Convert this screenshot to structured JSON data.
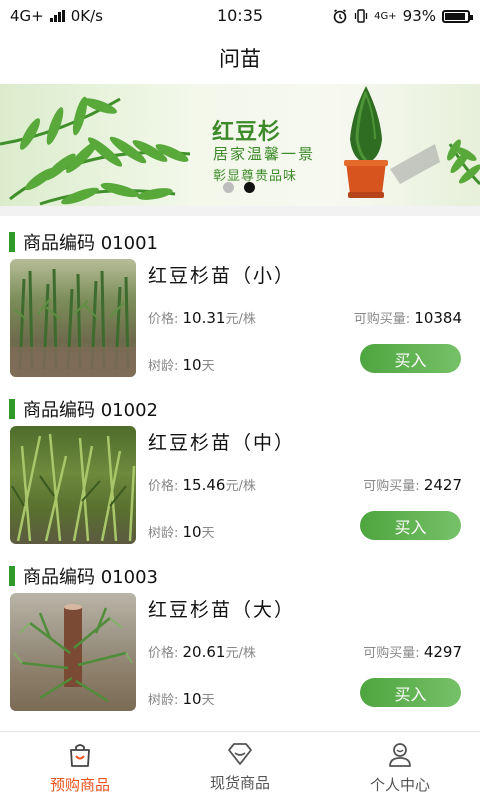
{
  "status_bar": {
    "network": "4G+",
    "speed": "0K/s",
    "time": "10:35",
    "network_right": "4G+",
    "battery": "93%",
    "battery_level": 0.93
  },
  "header": {
    "title": "问苗"
  },
  "banner": {
    "title": "红豆杉",
    "subtitle": "居家温馨一景",
    "tagline": "彰显尊贵品味",
    "active_slide": 2,
    "slide_count": 2
  },
  "labels": {
    "price_label": "价格: ",
    "price_unit": "元/株",
    "qty_label": "可购买量: ",
    "age_label": "树龄: ",
    "age_unit": "天",
    "buy_button": "买入"
  },
  "products": [
    {
      "code": "商品编码 01001",
      "name": "红豆杉苗（小）",
      "price": "10.31",
      "qty": "10384",
      "age": "10"
    },
    {
      "code": "商品编码 01002",
      "name": "红豆杉苗（中）",
      "price": "15.46",
      "qty": "2427",
      "age": "10"
    },
    {
      "code": "商品编码 01003",
      "name": "红豆杉苗（大）",
      "price": "20.61",
      "qty": "4297",
      "age": "10"
    }
  ],
  "bottom_nav": [
    {
      "label": "预购商品",
      "icon": "shopping-bag-icon",
      "active": true
    },
    {
      "label": "现货商品",
      "icon": "diamond-icon",
      "active": false
    },
    {
      "label": "个人中心",
      "icon": "user-icon",
      "active": false
    }
  ],
  "colors": {
    "accent_green": "#2f9a27",
    "nav_active": "#e8541e",
    "nav_inactive": "#555555"
  }
}
